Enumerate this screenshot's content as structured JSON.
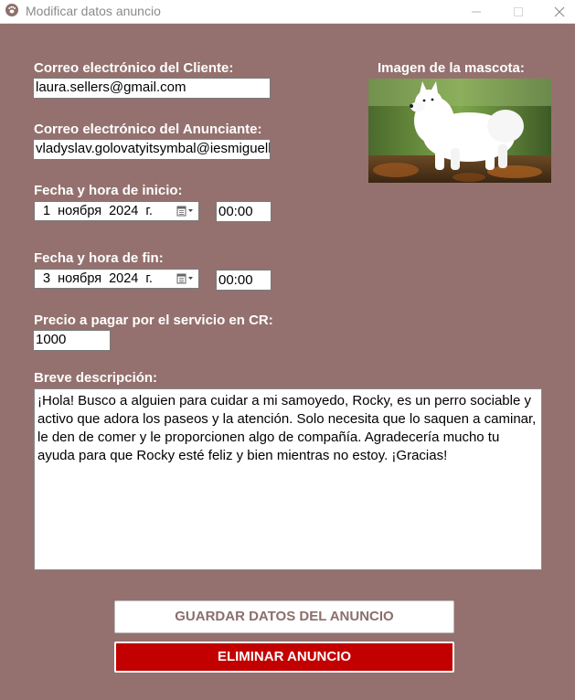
{
  "window": {
    "title": "Modificar datos anuncio",
    "icon": "paw-icon"
  },
  "form": {
    "client_email_label": "Correo electrónico del Cliente:",
    "client_email_value": "laura.sellers@gmail.com",
    "advertiser_email_label": "Correo electrónico del Anunciante:",
    "advertiser_email_value": "vladyslav.golovatyitsymbal@iesmiguelherrero.com",
    "start_label": "Fecha y hora de inicio:",
    "start_date": "1  ноября  2024 г.",
    "start_time": "00:00",
    "end_label": "Fecha y hora de fin:",
    "end_date": "3  ноября  2024 г.",
    "end_time": "00:00",
    "price_label": "Precio a pagar por el servicio en CR:",
    "price_value": "1000",
    "description_label": "Breve descripción:",
    "description_value": "¡Hola! Busco a alguien para cuidar a mi samoyedo, Rocky, es un perro sociable y activo que adora los paseos y la atención. Solo necesita que lo saquen a caminar, le den de comer y le proporcionen algo de compañía. Agradecería mucho tu ayuda para que Rocky esté feliz y bien mientras no estoy. ¡Gracias!"
  },
  "pet": {
    "image_label": "Imagen de la mascota:"
  },
  "actions": {
    "save_label": "GUARDAR DATOS DEL ANUNCIO",
    "delete_label": "ELIMINAR ANUNCIO"
  },
  "colors": {
    "background": "#94716e",
    "delete_button": "#c20000",
    "save_text": "#8b6f6c"
  }
}
